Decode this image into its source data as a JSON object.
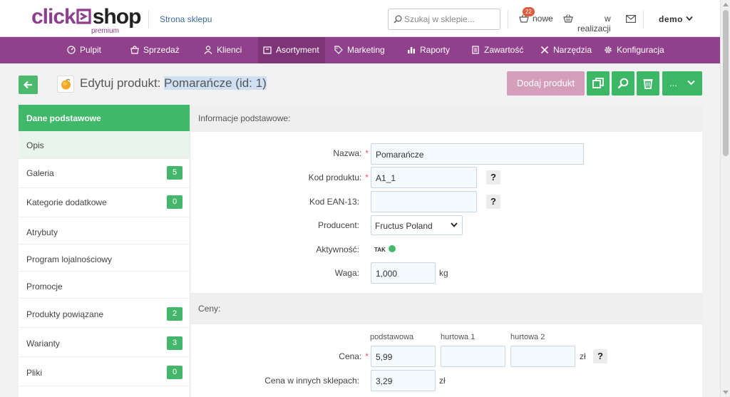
{
  "header": {
    "logo": {
      "click": "click",
      "shop": "shop",
      "premium": "premium"
    },
    "store_link": "Strona sklepu",
    "search_placeholder": "Szukaj w sklepie...",
    "orders_new_count": "22",
    "orders_new_label": "nowe",
    "orders_in_progress_label": "w realizacji",
    "user": "demo"
  },
  "nav": [
    {
      "label": "Pulpit",
      "icon": "dashboard-icon"
    },
    {
      "label": "Sprzedaż",
      "icon": "cart-icon"
    },
    {
      "label": "Klienci",
      "icon": "user-icon"
    },
    {
      "label": "Asortyment",
      "icon": "box-icon",
      "active": true
    },
    {
      "label": "Marketing",
      "icon": "tag-icon"
    },
    {
      "label": "Raporty",
      "icon": "bar-chart-icon"
    },
    {
      "label": "Zawartość",
      "icon": "document-icon"
    },
    {
      "label": "Narzędzia",
      "icon": "tools-icon"
    },
    {
      "label": "Konfiguracja",
      "icon": "gear-icon"
    }
  ],
  "page": {
    "title_prefix": "Edytuj produkt: ",
    "title_highlight": "Pomarańcze (id: 1)",
    "add_product_label": "Dodaj produkt",
    "more_label": "..."
  },
  "side_menu": [
    {
      "label": "Dane podstawowe",
      "active": true
    },
    {
      "label": "Opis",
      "hover": true
    },
    {
      "label": "Galeria",
      "count": "5"
    },
    {
      "label": "Kategorie dodatkowe",
      "count": "0"
    },
    {
      "label": "Atrybuty"
    },
    {
      "label": "Program lojalnościowy"
    },
    {
      "label": "Promocje"
    },
    {
      "label": "Produkty powiązane",
      "count": "2"
    },
    {
      "label": "Warianty",
      "count": "3"
    },
    {
      "label": "Pliki",
      "count": "0"
    }
  ],
  "basic_info": {
    "section_title": "Informacje podstawowe:",
    "name_label": "Nazwa:",
    "name_value": "Pomarańcze",
    "code_label": "Kod produktu:",
    "code_value": "A1_1",
    "ean_label": "Kod EAN-13:",
    "ean_value": "",
    "producer_label": "Producent:",
    "producer_value": "Fructus Poland",
    "active_label": "Aktywność:",
    "active_value": "TAK",
    "weight_label": "Waga:",
    "weight_value": "1,000",
    "weight_unit": "kg",
    "help": "?",
    "required_mark": "*"
  },
  "prices": {
    "section_title": "Ceny:",
    "col_retail": "podstawowa",
    "col_wholesale1": "hurtowa 1",
    "col_wholesale2": "hurtowa 2",
    "price_label": "Cena:",
    "price_retail": "5,99",
    "price_wholesale1": "",
    "price_wholesale2": "",
    "currency": "zł",
    "other_price_label": "Cena w innych sklepach:",
    "other_price_value": "3,29"
  },
  "colors": {
    "purple": "#91418b",
    "green": "#3cb766",
    "pink_button": "#d69ebd"
  }
}
